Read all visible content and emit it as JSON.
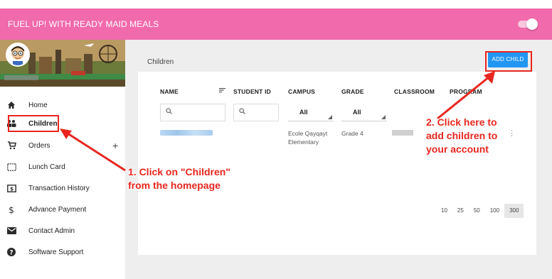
{
  "app": {
    "title": "FUEL UP! WITH READY MAID MEALS",
    "accent_color": "#f06aac",
    "toggle_icon": "toggle-switch"
  },
  "sidebar": {
    "items": [
      {
        "label": "Home",
        "icon": "home-icon"
      },
      {
        "label": "Children",
        "icon": "children-icon"
      },
      {
        "label": "Orders",
        "icon": "cart-icon",
        "expand": "+"
      },
      {
        "label": "Lunch Card",
        "icon": "card-icon"
      },
      {
        "label": "Transaction History",
        "icon": "dollar-box-icon"
      },
      {
        "label": "Advance Payment",
        "icon": "dollar-icon"
      },
      {
        "label": "Contact Admin",
        "icon": "mail-icon"
      },
      {
        "label": "Software Support",
        "icon": "help-icon"
      }
    ]
  },
  "main": {
    "page_title": "Children",
    "add_child_label": "ADD CHILD",
    "button_color": "#2196f3",
    "columns": [
      "NAME",
      "STUDENT ID",
      "CAMPUS",
      "GRADE",
      "CLASSROOM",
      "PROGRAM"
    ],
    "filters": {
      "campus": "All",
      "grade": "All"
    },
    "rows": [
      {
        "campus_line1": "Ecole Qayqayt",
        "campus_line2": "Elementary",
        "grade": "Grade 4"
      }
    ],
    "page_sizes": [
      "10",
      "25",
      "50",
      "100",
      "300"
    ],
    "selected_page_size": "300"
  },
  "annotations": {
    "step1_line1": "1. Click on \"Children\"",
    "step1_line2": "from the homepage",
    "step2_line1": "2. Click here to",
    "step2_line2": "add children to",
    "step2_line3": "your account",
    "color": "#e8261f"
  }
}
